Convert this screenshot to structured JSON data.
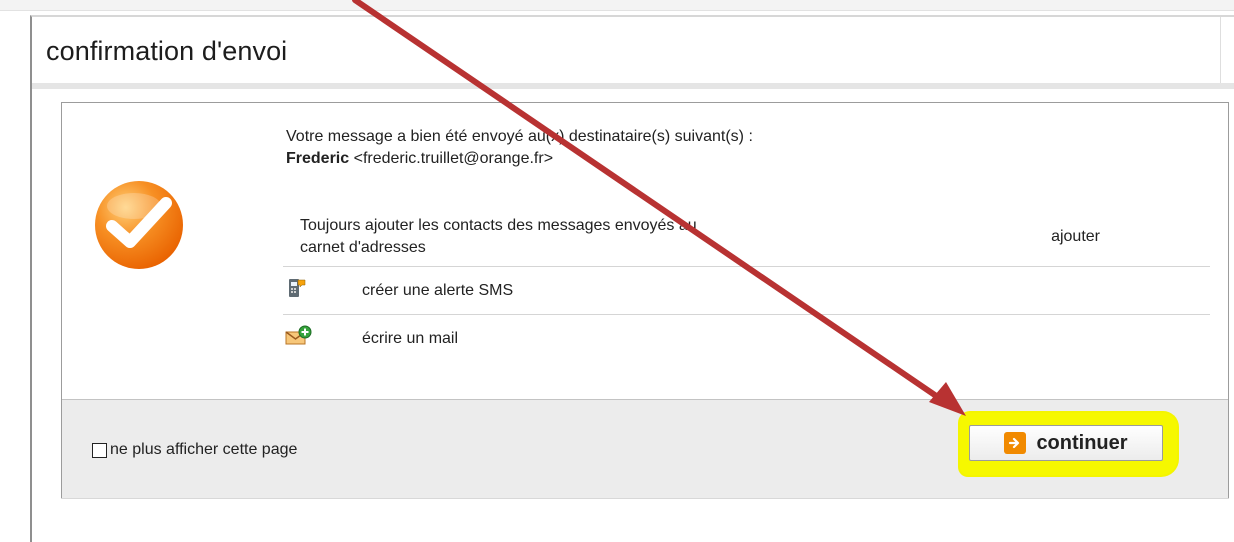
{
  "page": {
    "title": "confirmation d'envoi"
  },
  "confirmation": {
    "message": "Votre message a bien été envoyé au(x) destinataire(s) suivant(s) :",
    "recipient_name": "Frederic",
    "recipient_email": "<frederic.truillet@orange.fr>"
  },
  "options": {
    "contacts_line_1": "Toujours ajouter les contacts des messages envoyés au",
    "contacts_line_2": "carnet d'adresses",
    "ajouter_label": "ajouter",
    "sms_label": "créer une alerte SMS",
    "mail_label": "écrire un mail"
  },
  "footer": {
    "checkbox_label": "ne plus afficher cette page",
    "continue_label": "continuer"
  },
  "icons": {
    "badge": "checkmark-badge-icon",
    "sms": "sms-alert-icon",
    "mail": "new-mail-icon",
    "continue": "continue-arrow-icon"
  },
  "colors": {
    "accent_orange": "#e07b00",
    "badge_orange": "#f18a00",
    "highlight_yellow": "#f6f800",
    "annotation_red": "#b83232"
  }
}
